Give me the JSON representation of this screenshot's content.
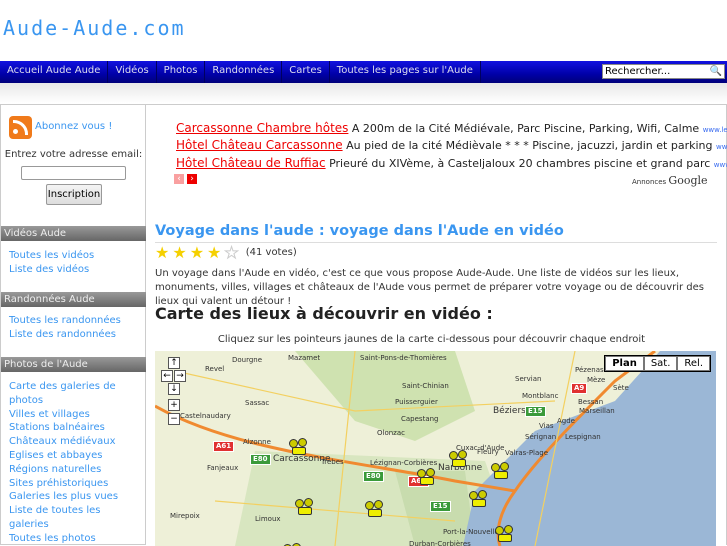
{
  "site": {
    "logo": "Aude-Aude.com"
  },
  "nav": {
    "items": [
      "Accueil Aude Aude",
      "Vidéos",
      "Photos",
      "Randonnées",
      "Cartes",
      "Toutes les pages sur l'Aude"
    ],
    "search_placeholder": "Rechercher..."
  },
  "sidebar": {
    "subscribe": "Abonnez vous !",
    "email_label": "Entrez votre adresse email:",
    "subscribe_button": "Inscription",
    "sections": [
      {
        "title": "Vidéos Aude",
        "links": [
          "Toutes les vidéos",
          "Liste des vidéos"
        ]
      },
      {
        "title": "Randonnées Aude",
        "links": [
          "Toutes les randonnées",
          "Liste des randonnées"
        ]
      },
      {
        "title": "Photos de l'Aude",
        "links": [
          "Carte des galeries de photos",
          "Villes et villages",
          "Stations balnéaires",
          "Châteaux médiévaux",
          "Eglises et abbayes",
          "Régions naturelles",
          "Sites préhistoriques",
          "Galeries les plus vues",
          "Liste de toutes les galeries",
          "Toutes les photos"
        ]
      }
    ]
  },
  "ads": {
    "items": [
      {
        "title": "Carcassonne Chambre hôtes",
        "desc": "A 200m de la Cité Médiévale, Parc Piscine, Parking, Wifi, Calme",
        "url": "www.lesp..."
      },
      {
        "title": "Hôtel Château Carcassonne",
        "desc": "Au pied de la cité Médièvale * * * Piscine, jacuzzi, jardin et parking",
        "url": "www.h..."
      },
      {
        "title": "Hôtel Château de Ruffiac",
        "desc": "Prieuré du XIVème, à Casteljaloux 20 chambres piscine et grand parc",
        "url": "www.h..."
      }
    ],
    "label": "Annonces",
    "brand": "Google"
  },
  "main": {
    "title": "Voyage dans l'aude : voyage dans l'Aude en vidéo",
    "rating": {
      "stars": 4,
      "max": 5,
      "votes": "(41 votes)"
    },
    "intro": "Un voyage dans l'Aude en vidéo, c'est ce que vous propose Aude-Aude. Une liste de vidéos sur les lieux, monuments, villes, villages et châteaux de l'Aude vous permet de préparer votre voyage ou de découvrir des lieux qui valent un détour !",
    "map_heading": "Carte des lieux à découvrir en vidéo :",
    "map_hint": "Cliquez sur les pointeurs jaunes de la carte ci-dessous pour découvrir chaque endroit"
  },
  "map": {
    "types": [
      "Plan",
      "Sat.",
      "Rel."
    ],
    "cities": [
      "Dourgne",
      "Mazamet",
      "Saint-Pons-de-Thomières",
      "Revel",
      "Pézenas",
      "Servian",
      "Mèze",
      "Sète",
      "Saint-Chinian",
      "Montblanc",
      "Bessan",
      "Puisserguier",
      "Béziers",
      "Marseillan",
      "Sassac",
      "Castelnaudary",
      "Capestang",
      "Agde",
      "Vias",
      "Olonzac",
      "Alzonne",
      "Lespignan",
      "Sérignan",
      "Cuxac-d'Aude",
      "Fleury",
      "Valras-Plage",
      "Carcassonne",
      "Trèbes",
      "Fanjeaux",
      "Lézignan-Corbières",
      "Narbonne",
      "Mirepoix",
      "Limoux",
      "Port-la-Nouvelle",
      "Durban-Corbières"
    ],
    "roads": [
      "A61",
      "E80",
      "E80",
      "A61",
      "E15",
      "E15",
      "A9"
    ]
  }
}
